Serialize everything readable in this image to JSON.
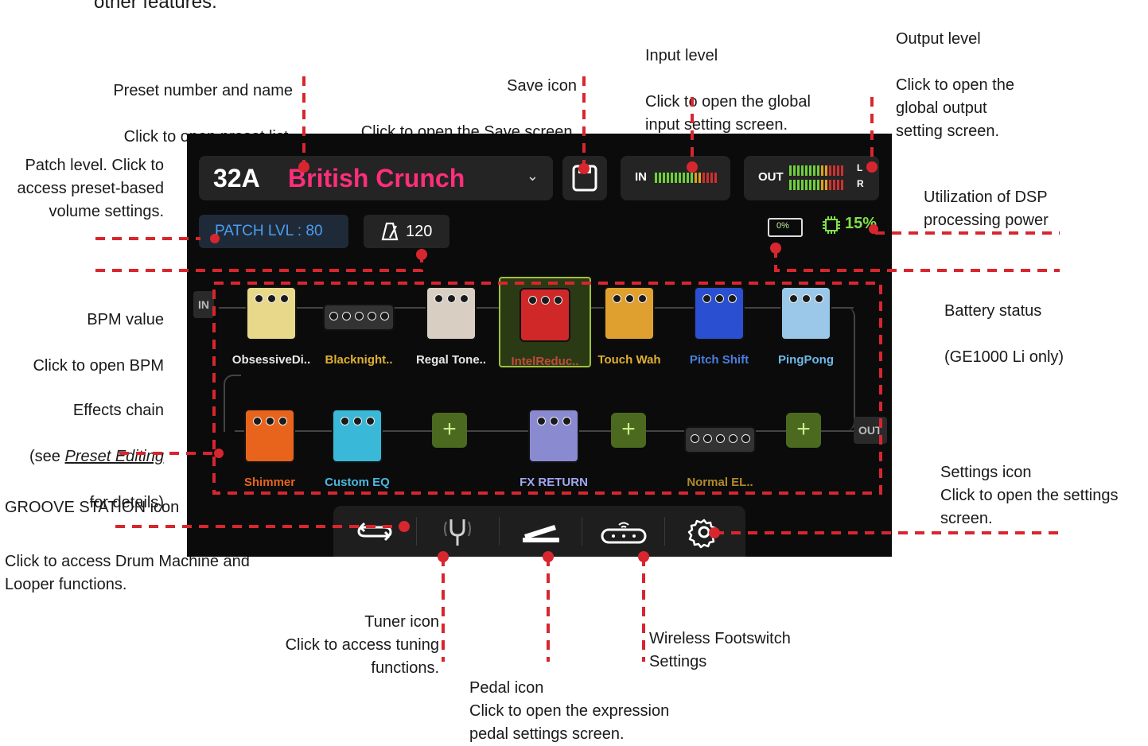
{
  "header_text": "other features.",
  "screen": {
    "preset": {
      "number": "32A",
      "name": "British Crunch"
    },
    "input_meter": {
      "label": "IN"
    },
    "output_meter": {
      "label": "OUT",
      "left": "L",
      "right": "R"
    },
    "patch_level": "PATCH LVL : 80",
    "bpm": "120",
    "battery": "0%",
    "dsp": "15%",
    "chain": {
      "in_label": "IN",
      "out_label": "OUT",
      "row1": [
        {
          "name": "ObsessiveDi..",
          "color": "#e8d98a",
          "name_color": "#e8e8e8",
          "icon": "overdrive-pedal-icon"
        },
        {
          "name": "Blacknight..",
          "color": "#333333",
          "name_color": "#e0b030",
          "icon": "amp-head-icon"
        },
        {
          "name": "Regal Tone..",
          "color": "#d8cfc2",
          "name_color": "#e8e8e8",
          "icon": "cab-icon"
        },
        {
          "name": "IntelReduc..",
          "color": "#d02828",
          "name_color": "#c24a3a",
          "icon": "noise-gate-pedal-icon",
          "selected": true
        },
        {
          "name": "Touch Wah",
          "color": "#e0a030",
          "name_color": "#e0b030",
          "icon": "filter-pedal-icon"
        },
        {
          "name": "Pitch Shift",
          "color": "#2a4fd0",
          "name_color": "#4a7de0",
          "icon": "mod-pedal-icon"
        },
        {
          "name": "PingPong",
          "color": "#9bc8e8",
          "name_color": "#6fb8e8",
          "icon": "delay-pedal-icon"
        }
      ],
      "row2": [
        {
          "name": "Shimmer",
          "color": "#e8641c",
          "name_color": "#e8641c",
          "icon": "reverb-pedal-icon"
        },
        {
          "name": "Custom EQ",
          "color": "#3ab8d8",
          "name_color": "#4ab8e0",
          "icon": "eq-pedal-icon"
        },
        {
          "name": "FX RETURN",
          "color": "#8a8ad0",
          "name_color": "#a0a8f0",
          "icon": "fx-loop-icon"
        },
        {
          "name": "Normal EL..",
          "color": "#333333",
          "name_color": "#b08a2a",
          "icon": "amp-head-icon"
        }
      ]
    },
    "bottom_bar": {
      "icons": [
        "groove-station-icon",
        "tuner-icon",
        "pedal-icon",
        "wireless-footswitch-icon",
        "settings-icon"
      ]
    }
  },
  "annotations": {
    "preset": {
      "title": "Preset number and name",
      "desc": "Click to open preset list."
    },
    "save": {
      "title": "Save icon",
      "desc": "Click to open the Save screen."
    },
    "input": {
      "title": "Input level",
      "desc": " Click to open the global\ninput setting screen."
    },
    "output": {
      "title": "Output level",
      "desc": " Click to open the\nglobal output\nsetting screen."
    },
    "patch": {
      "text": "Patch level. Click to\naccess preset-based\nvolume settings."
    },
    "dsp": {
      "text": "Utilization of DSP\nprocessing power"
    },
    "bpm": {
      "title": "BPM value",
      "desc": "Click to open BPM"
    },
    "battery": {
      "title": "Battery status",
      "desc": "(GE1000 Li only)"
    },
    "chain": {
      "line1": "Effects chain",
      "line2_pre": "(see ",
      "line2_link": "Preset Editing",
      "line3": "for details)"
    },
    "groove": {
      "title": "GROOVE STATION icon",
      "desc": "Click to access Drum Machine and\nLooper functions."
    },
    "settings": {
      "text": "Settings icon\nClick to open the settings\nscreen."
    },
    "tuner": {
      "text": "Tuner icon\nClick to access tuning\nfunctions."
    },
    "pedal": {
      "text": "Pedal icon\nClick to open the expression\npedal settings screen."
    },
    "wireless": {
      "text": "Wireless Footswitch\nSettings"
    }
  },
  "colors": {
    "accent_red": "#d8262e",
    "preset_pink": "#ff2e7a",
    "dsp_green": "#7fe04a",
    "patch_blue": "#4a9df0"
  }
}
